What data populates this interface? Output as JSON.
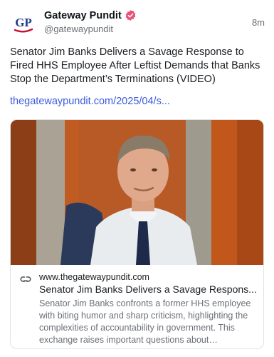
{
  "author": {
    "display_name": "Gateway Pundit",
    "handle": "@gatewaypundit",
    "avatar_initials": "GP",
    "verified": true,
    "verified_badge_color": "#e8507a"
  },
  "post": {
    "timestamp": "8m",
    "text": "Senator Jim Banks Delivers a Savage Response to Fired HHS Employee After Leftist Demands that Banks Stop the Department’s Terminations (VIDEO)",
    "link_text": "thegatewaypundit.com/2025/04/s..."
  },
  "link_card": {
    "icon": "link-icon",
    "domain": "www.thegatewaypundit.com",
    "title": "Senator Jim Banks Delivers a Savage Respons...",
    "description": "Senator Jim Banks confronts a former HHS employee with biting humor and sharp criticism, highlighting the complexities of accountability in government. This exchange raises important questions about workplace..."
  },
  "colors": {
    "link": "#3b5bdb",
    "muted_text": "#6b6f76",
    "brand_blue": "#1f3a8a",
    "brand_red": "#c8102e"
  }
}
